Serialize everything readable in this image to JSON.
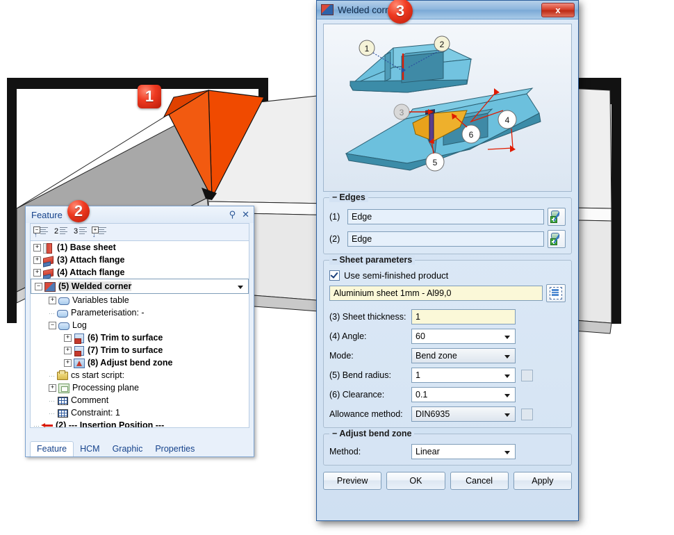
{
  "viewport": {
    "badge1": "1"
  },
  "feature_panel": {
    "title": "Feature",
    "badge": "2",
    "pin_icon": "pin-icon",
    "close_icon": "close-icon",
    "toolbar": [
      {
        "name": "collapse-all-button",
        "glyph": "−",
        "arrow": "↑"
      },
      {
        "name": "expand-level-2-button",
        "num": "2"
      },
      {
        "name": "expand-level-3-button",
        "num": "3"
      },
      {
        "name": "expand-all-button",
        "glyph": "+",
        "arrow": "↓"
      }
    ],
    "tree": [
      {
        "indent": 0,
        "expander": "+",
        "icon": "sheet-red",
        "label": "(1) Base sheet",
        "bold": true,
        "selected": false
      },
      {
        "indent": 0,
        "expander": "+",
        "icon": "flange",
        "label": "(3) Attach flange",
        "bold": true,
        "selected": false
      },
      {
        "indent": 0,
        "expander": "+",
        "icon": "flange",
        "label": "(4) Attach flange",
        "bold": true,
        "selected": false
      },
      {
        "indent": 0,
        "expander": "-",
        "icon": "corner",
        "label": "(5) Welded corner",
        "bold": true,
        "selected": true
      },
      {
        "indent": 1,
        "expander": "+",
        "icon": "blue-rr",
        "label": "Variables table",
        "bold": false,
        "selected": false
      },
      {
        "indent": 1,
        "expander": "",
        "icon": "blue-rr",
        "label": "Parameterisation: -",
        "bold": false,
        "selected": false
      },
      {
        "indent": 1,
        "expander": "-",
        "icon": "blue-rr",
        "label": "Log",
        "bold": false,
        "selected": false
      },
      {
        "indent": 2,
        "expander": "+",
        "icon": "trim",
        "label": "(6) Trim to surface",
        "bold": true,
        "selected": false
      },
      {
        "indent": 2,
        "expander": "+",
        "icon": "trim",
        "label": "(7) Trim to surface",
        "bold": true,
        "selected": false
      },
      {
        "indent": 2,
        "expander": "+",
        "icon": "bend",
        "label": "(8) Adjust bend zone",
        "bold": true,
        "selected": false
      },
      {
        "indent": 1,
        "expander": "",
        "icon": "script",
        "label": "cs start script:",
        "bold": false,
        "selected": false
      },
      {
        "indent": 1,
        "expander": "+",
        "icon": "plane",
        "label": "Processing plane",
        "bold": false,
        "selected": false
      },
      {
        "indent": 1,
        "expander": "",
        "icon": "grid",
        "label": "Comment",
        "bold": false,
        "selected": false
      },
      {
        "indent": 1,
        "expander": "",
        "icon": "grid",
        "label": "Constraint: 1",
        "bold": false,
        "selected": false
      },
      {
        "indent": 0,
        "expander": "",
        "icon": "arrow-red",
        "label": "(2) --- Insertion Position ---",
        "bold": true,
        "selected": false
      }
    ],
    "tabs": [
      {
        "label": "Feature",
        "active": true
      },
      {
        "label": "HCM",
        "active": false
      },
      {
        "label": "Graphic",
        "active": false
      },
      {
        "label": "Properties",
        "active": false
      }
    ]
  },
  "dialog": {
    "title": "Welded corner",
    "badge": "3",
    "close_label": "x",
    "preview_callouts": [
      "1",
      "2",
      "3",
      "4",
      "5",
      "6"
    ],
    "edges_group": {
      "title": "Edges",
      "rows": [
        {
          "index": "(1)",
          "value": "Edge"
        },
        {
          "index": "(2)",
          "value": "Edge"
        }
      ]
    },
    "sheet_group": {
      "title": "Sheet parameters",
      "semi_finished_label": "Use semi-finished product",
      "semi_finished_checked": true,
      "material": "Aluminium sheet 1mm - Al99,0",
      "thickness_label": "(3) Sheet thickness:",
      "thickness_value": "1",
      "angle_label": "(4) Angle:",
      "angle_value": "60",
      "mode_label": "Mode:",
      "mode_value": "Bend zone",
      "bend_radius_label": "(5) Bend radius:",
      "bend_radius_value": "1",
      "clearance_label": "(6) Clearance:",
      "clearance_value": "0.1",
      "allowance_label": "Allowance method:",
      "allowance_value": "DIN6935"
    },
    "adjust_group": {
      "title": "Adjust bend zone",
      "method_label": "Method:",
      "method_value": "Linear"
    },
    "buttons": [
      {
        "label": "Preview",
        "name": "preview-button"
      },
      {
        "label": "OK",
        "name": "ok-button"
      },
      {
        "label": "Cancel",
        "name": "cancel-button"
      },
      {
        "label": "Apply",
        "name": "apply-button"
      }
    ]
  },
  "colors": {
    "accent": "#2b5d9b",
    "badge_red": "#d6412c",
    "highlight_orange": "#f04a00",
    "field_yellow": "#fbf8d8",
    "field_blue": "#e6f0fb"
  }
}
